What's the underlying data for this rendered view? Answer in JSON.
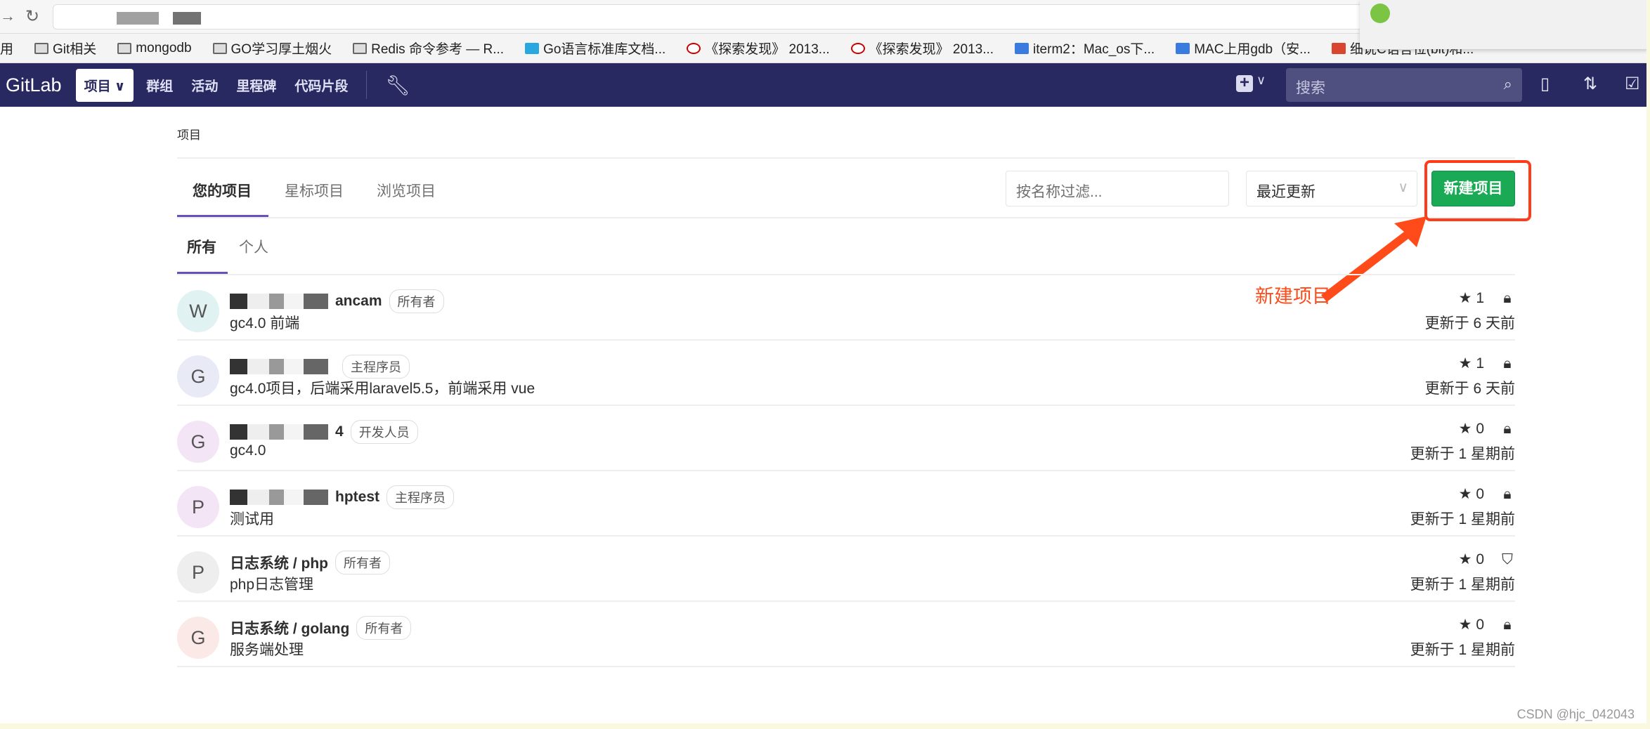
{
  "browser": {
    "bookmarks": [
      {
        "label": "用",
        "icon": "apps-icon"
      },
      {
        "label": "Git相关",
        "icon": "folder-icon"
      },
      {
        "label": "mongodb",
        "icon": "folder-icon"
      },
      {
        "label": "GO学习厚土烟火",
        "icon": "folder-icon"
      },
      {
        "label": "Redis 命令参考 — R...",
        "icon": "page-icon"
      },
      {
        "label": "Go语言标准库文档...",
        "icon": "go-icon"
      },
      {
        "label": "《探索发现》 2013...",
        "icon": "cctv-icon"
      },
      {
        "label": "《探索发现》 2013...",
        "icon": "cctv-icon"
      },
      {
        "label": "iterm2：Mac_os下...",
        "icon": "baidu-icon"
      },
      {
        "label": "MAC上用gdb（安...",
        "icon": "baidu-icon"
      },
      {
        "label": "细说C语言位(bit)和...",
        "icon": "csdn-icon"
      }
    ]
  },
  "nav": {
    "logo": "GitLab",
    "projects": "项目",
    "caret": "⌄",
    "groups": "群组",
    "activity": "活动",
    "milestones": "里程碑",
    "snippets": "代码片段",
    "search_placeholder": "搜索"
  },
  "breadcrumb": "项目",
  "tabs": [
    "您的项目",
    "星标项目",
    "浏览项目"
  ],
  "filter_placeholder": "按名称过滤...",
  "sort_selected": "最近更新",
  "new_project": "新建项目",
  "annotation": "新建项目",
  "subtabs": [
    "所有",
    "个人"
  ],
  "projects": [
    {
      "initial": "W",
      "name": "ancam",
      "role": "所有者",
      "desc": "gc4.0 前端",
      "stars": "1",
      "visibility": "private",
      "updated": "更新于 6 天前",
      "avatar_color": "#e0f2f1"
    },
    {
      "initial": "G",
      "name": "",
      "role": "主程序员",
      "desc": "gc4.0项目，后端采用laravel5.5，前端采用 vue",
      "stars": "1",
      "visibility": "private",
      "updated": "更新于 6 天前",
      "avatar_color": "#e8eaf6"
    },
    {
      "initial": "G",
      "name": "4",
      "role": "开发人员",
      "desc": "gc4.0",
      "stars": "0",
      "visibility": "private",
      "updated": "更新于 1 星期前",
      "avatar_color": "#f3e5f5"
    },
    {
      "initial": "P",
      "name": "hptest",
      "role": "主程序员",
      "desc": "测试用",
      "stars": "0",
      "visibility": "private",
      "updated": "更新于 1 星期前",
      "avatar_color": "#f3e5f5"
    },
    {
      "initial": "P",
      "name": "日志系统 / php",
      "role": "所有者",
      "desc": "php日志管理",
      "stars": "0",
      "visibility": "internal",
      "updated": "更新于 1 星期前",
      "avatar_color": "#eeeeee"
    },
    {
      "initial": "G",
      "name": "日志系统 / golang",
      "role": "所有者",
      "desc": "服务端处理",
      "stars": "0",
      "visibility": "private",
      "updated": "更新于 1 星期前",
      "avatar_color": "#fbe9e7"
    }
  ],
  "watermark": "CSDN @hjc_042043"
}
